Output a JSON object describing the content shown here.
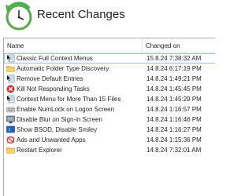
{
  "header": {
    "title": "Recent Changes",
    "logo_icon": "clock-history-icon",
    "logo_colors": {
      "arrow": "#4caf50",
      "face": "#ffffff"
    }
  },
  "list": {
    "columns": {
      "name": "Name",
      "changed_on": "Changed on"
    },
    "rows": [
      {
        "name": "Classic Full Context Menus",
        "changed_on": "15.8.24 7:38:32 AM",
        "icon": "context-menu-icon",
        "selected": true
      },
      {
        "name": "Automatic Folder Type Discovery",
        "changed_on": "14.8.24 6:17:19 PM",
        "icon": "folder-icon"
      },
      {
        "name": "Remove Default Entries",
        "changed_on": "14.8.24 1:49:21 PM",
        "icon": "context-menu-icon"
      },
      {
        "name": "Kill Not Responding Tasks",
        "changed_on": "14.8.24 1:45:45 PM",
        "icon": "stop-icon"
      },
      {
        "name": "Context Menu for More Than 15 Files",
        "changed_on": "14.8.24 1:45:29 PM",
        "icon": "context-menu-icon"
      },
      {
        "name": "Enable NumLock on Logon Screen",
        "changed_on": "14.8.24 1:16:57 PM",
        "icon": "keyboard-icon"
      },
      {
        "name": "Disable Blur on Sign-in Screen",
        "changed_on": "14.8.24 1:16:46 PM",
        "icon": "monitor-icon"
      },
      {
        "name": "Show BSOD, Disable Smiley",
        "changed_on": "14.8.24 1:16:27 PM",
        "icon": "bsod-icon"
      },
      {
        "name": "Ads and Unwanted Apps",
        "changed_on": "14.8.24 1:15:36 PM",
        "icon": "no-ads-icon"
      },
      {
        "name": "Restart Explorer",
        "changed_on": "14.8.24 7:32:01 AM",
        "icon": "folder-icon"
      }
    ]
  }
}
